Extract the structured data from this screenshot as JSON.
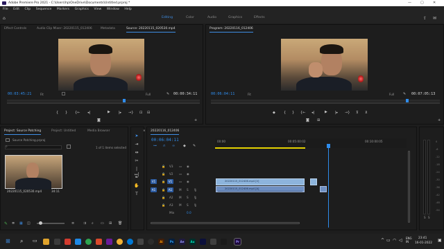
{
  "window": {
    "title": "Adobe Premiere Pro 2021 - C:\\Users\\hp\\OneDrive\\Documents\\Untitled.prproj *",
    "controls": [
      "—",
      "▢",
      "✕"
    ]
  },
  "menu": [
    "File",
    "Edit",
    "Clip",
    "Sequence",
    "Markers",
    "Graphics",
    "View",
    "Window",
    "Help"
  ],
  "workspaces": {
    "items": [
      "Editing",
      "Color",
      "Audio",
      "Graphics",
      "Effects"
    ],
    "active": "Editing"
  },
  "source_monitor": {
    "tabs": [
      "Effect Controls",
      "Audio Clip Mixer: 20220115_012406",
      "Metadata",
      "Source: 20220115_020530.mp4"
    ],
    "active_tab": "Source: 20220115_020530.mp4",
    "current_time": "00:03:45:21",
    "zoom": "Fit",
    "quality": "Full",
    "duration": "00:00:34:11"
  },
  "program_monitor": {
    "title": "Program: 20220116_012406",
    "current_time": "00:06:04:11",
    "zoom": "Fit",
    "quality": "Full",
    "duration": "00:07:05:13"
  },
  "project_panel": {
    "tabs": [
      "Project: Source Patching",
      "Project: Untitled",
      "Media Browser"
    ],
    "active_tab": "Project: Source Patching",
    "path": "Source Patching.prproj",
    "selection_info": "1 of 1 items selected",
    "clip": {
      "name": "20220115_020530.mp4",
      "duration": "34:11"
    }
  },
  "timeline": {
    "sequence_name": "20220116_012406",
    "current_time": "00:06:04:11",
    "ruler": [
      "00:00",
      "00:05:00:02",
      "00:10:00:05"
    ],
    "playhead_fraction": 0.59,
    "tracks": [
      {
        "name": "V3",
        "kind": "video"
      },
      {
        "name": "V2",
        "kind": "video"
      },
      {
        "name": "V1",
        "kind": "video",
        "source_patch": "V1"
      },
      {
        "name": "A1",
        "kind": "audio",
        "source_patch": "A1"
      },
      {
        "name": "A2",
        "kind": "audio"
      },
      {
        "name": "A3",
        "kind": "audio"
      },
      {
        "name": "Mix",
        "kind": "mix",
        "value": "0.0"
      }
    ],
    "clips": [
      {
        "label": "20220115_012406.mp4 [V]",
        "track": "V1"
      },
      {
        "label": "20220115_012406.mp4 [A]",
        "track": "A1"
      }
    ]
  },
  "audio_meter": {
    "scale": [
      "0",
      "-6",
      "-12",
      "-18",
      "-24",
      "-30",
      "-36",
      "-42",
      "-48",
      "-54"
    ],
    "footer": [
      "S",
      "S"
    ]
  },
  "taskbar": {
    "time": "23:41",
    "date": "16-01-2022",
    "lang": "ENG\nIN",
    "apps": [
      "Ai",
      "Ps",
      "Ae",
      "Au",
      "Pr"
    ]
  }
}
